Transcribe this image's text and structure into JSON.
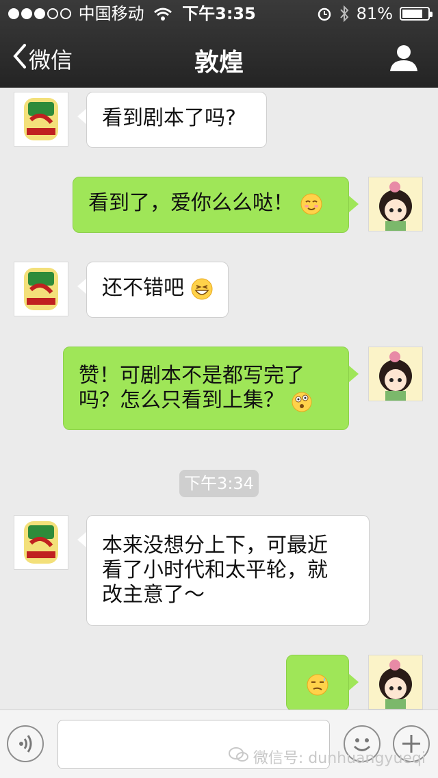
{
  "status_bar": {
    "carrier": "中国移动",
    "time": "下午3:35",
    "battery": "81%",
    "battery_level": 0.81,
    "signal_bars": 3
  },
  "nav": {
    "back_label": "微信",
    "title": "敦煌",
    "icons": [
      "chevron-left-icon",
      "person-icon"
    ]
  },
  "messages": [
    {
      "direction": "in",
      "text": "看到剧本了吗?"
    },
    {
      "direction": "out",
      "text": "看到了，爱你么么哒！",
      "emoji": "smile-blush"
    },
    {
      "direction": "in",
      "text": "还不错吧",
      "emoji": "grin"
    },
    {
      "direction": "out",
      "lines": [
        "赞！可剧本不是都写完了",
        "吗？怎么只看到上集？"
      ],
      "emoji": "dizzy"
    },
    {
      "direction": "in",
      "lines": [
        "本来没想分上下，可最近",
        "看了小时代和太平轮，就",
        "改主意了～"
      ]
    },
    {
      "direction": "out",
      "text": "",
      "emoji": "sweat-smirk"
    }
  ],
  "time_divider": "下午3:34",
  "input_bar": {
    "placeholder": "",
    "icons": [
      "voice-icon",
      "emoji-face-icon",
      "plus-icon"
    ]
  },
  "watermark": "微信号: dunhuangyueqi",
  "colors": {
    "nav_bg": "#2c2c2c",
    "chat_bg": "#ebebeb",
    "out_bubble": "#9fe658",
    "in_bubble": "#ffffff",
    "time_badge": "#cfcfcf"
  }
}
